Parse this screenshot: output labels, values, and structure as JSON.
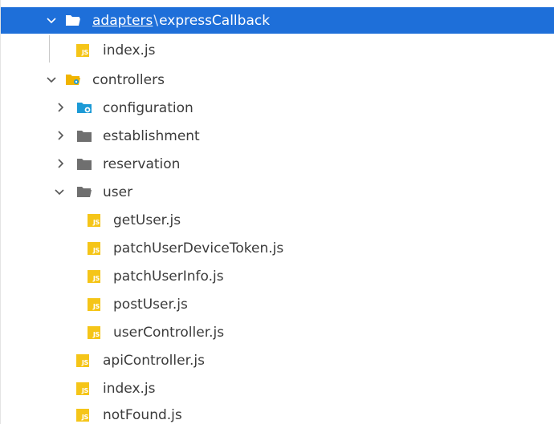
{
  "explorer": {
    "adapters_row": {
      "folder": "adapters",
      "separator": "\\",
      "subfolder": "expressCallback",
      "expanded": true,
      "selected": true
    },
    "rows": [
      {
        "label": "index.js",
        "type": "js"
      },
      {
        "label": "controllers",
        "type": "folder-special",
        "expanded": true
      },
      {
        "label": "configuration",
        "type": "folder-config",
        "expanded": false
      },
      {
        "label": "establishment",
        "type": "folder",
        "expanded": false
      },
      {
        "label": "reservation",
        "type": "folder",
        "expanded": false
      },
      {
        "label": "user",
        "type": "folder",
        "expanded": true
      },
      {
        "label": "getUser.js",
        "type": "js"
      },
      {
        "label": "patchUserDeviceToken.js",
        "type": "js"
      },
      {
        "label": "patchUserInfo.js",
        "type": "js"
      },
      {
        "label": "postUser.js",
        "type": "js"
      },
      {
        "label": "userController.js",
        "type": "js"
      },
      {
        "label": "apiController.js",
        "type": "js"
      },
      {
        "label": "index.js",
        "type": "js"
      },
      {
        "label": "notFound.js",
        "type": "js"
      }
    ],
    "colors": {
      "selection": "#1e6fd9",
      "js_icon": "#f5c518",
      "folder": "#6f6f6f",
      "folder_special": "#f0b400",
      "folder_config": "#1c9ad6"
    }
  }
}
